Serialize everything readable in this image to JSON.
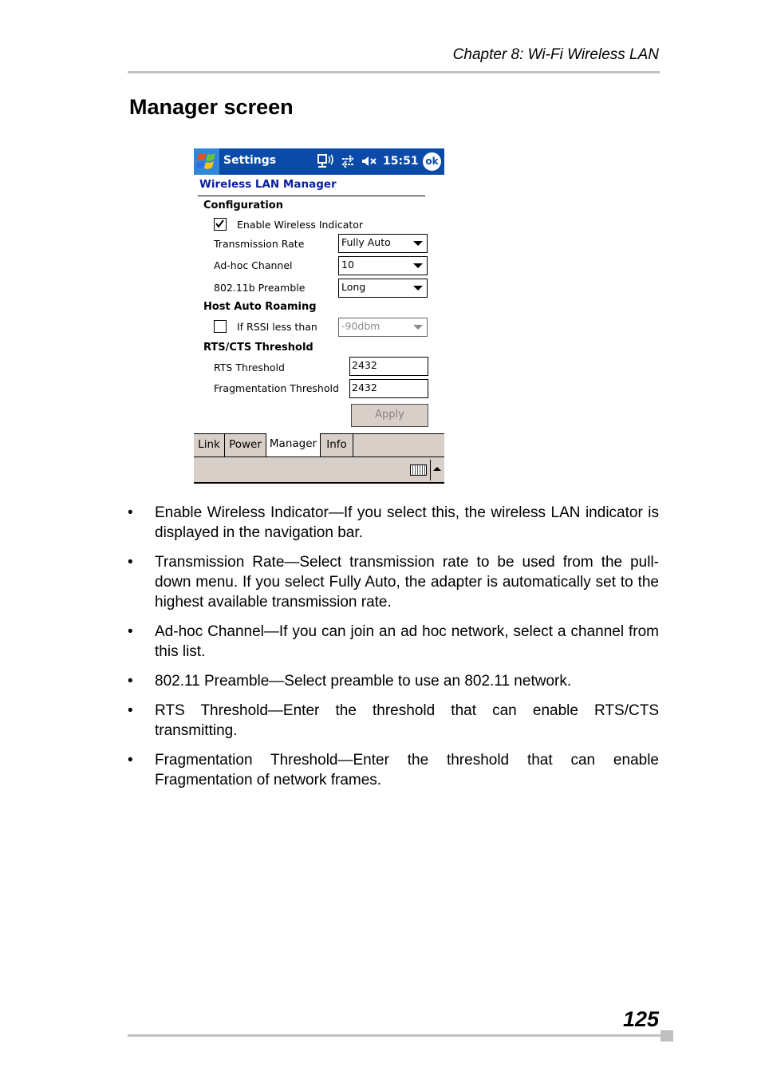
{
  "page": {
    "chapter_header": "Chapter 8: Wi-Fi Wireless LAN",
    "title": "Manager screen",
    "page_number": "125"
  },
  "pda": {
    "titlebar": {
      "title": "Settings",
      "time": "15:51",
      "ok_label": "ok",
      "icons": [
        "start-windows-icon",
        "wireless-network-icon",
        "connectivity-arrows-icon",
        "speaker-muted-icon"
      ]
    },
    "heading": "Wireless LAN Manager",
    "configuration": {
      "section_label": "Configuration",
      "enable_indicator": {
        "label": "Enable Wireless Indicator",
        "checked": true
      },
      "transmission_rate": {
        "label": "Transmission Rate",
        "value": "Fully Auto"
      },
      "adhoc_channel": {
        "label": "Ad-hoc Channel",
        "value": "10"
      },
      "preamble": {
        "label": "802.11b Preamble",
        "value": "Long"
      }
    },
    "roaming": {
      "section_label": "Host Auto Roaming",
      "rssi": {
        "label": "If RSSI less than",
        "checked": false,
        "value": "-90dbm",
        "enabled": false
      }
    },
    "rts": {
      "section_label": "RTS/CTS Threshold",
      "rts_threshold": {
        "label": "RTS Threshold",
        "value": "2432"
      },
      "frag_threshold": {
        "label": "Fragmentation Threshold",
        "value": "2432"
      }
    },
    "apply_label": "Apply",
    "tabs": [
      {
        "label": "Link",
        "active": false
      },
      {
        "label": "Power",
        "active": false
      },
      {
        "label": "Manager",
        "active": true
      },
      {
        "label": "Info",
        "active": false
      }
    ],
    "colors": {
      "titlebar": "#0b4aa8",
      "heading": "#0a1fa0",
      "chrome": "#d8cfc9"
    }
  },
  "bullets": [
    "Enable Wireless Indicator—If you select this, the wireless LAN indicator is displayed in the navigation bar.",
    "Transmission Rate—Select transmission rate to be used from the pull-down menu. If you select Fully Auto, the adapter is automatically set to the highest available transmission rate.",
    "Ad-hoc Channel—If you can join an ad hoc network, select a channel from this list.",
    "802.11 Preamble—Select preamble to use an 802.11 network.",
    "RTS Threshold—Enter the threshold that can enable RTS/CTS transmitting.",
    "Fragmentation Threshold—Enter the threshold that can enable Fragmentation of network frames."
  ],
  "bullet_glyph": "•"
}
